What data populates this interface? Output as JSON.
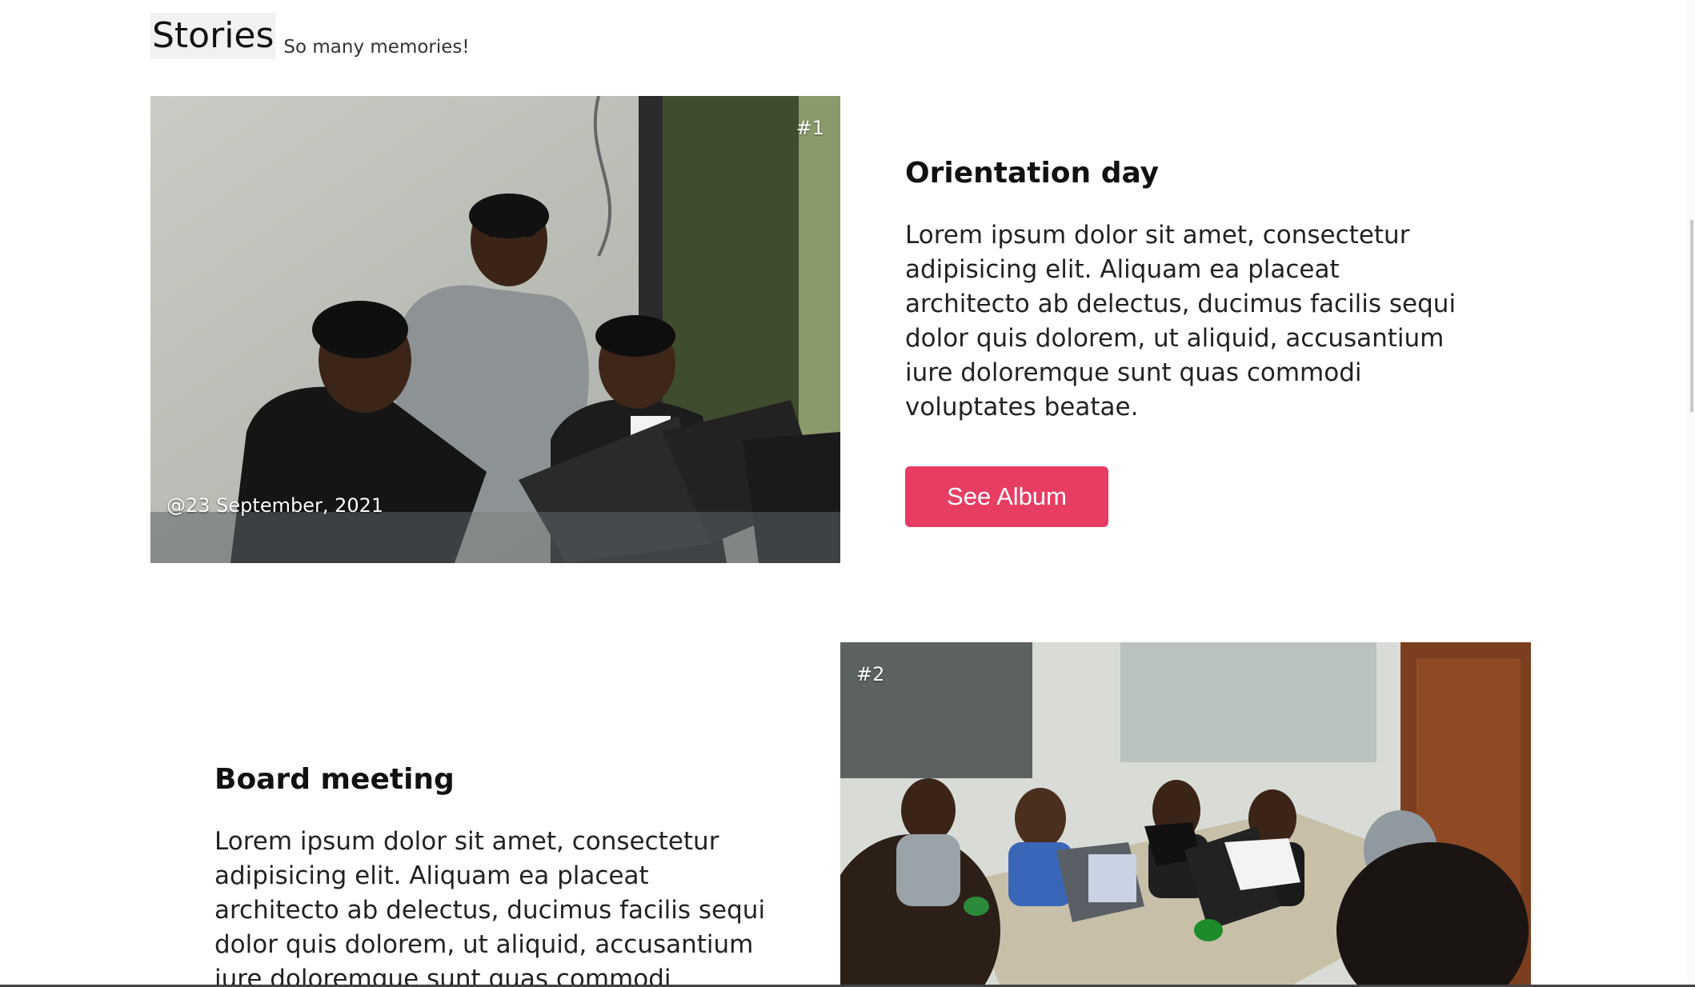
{
  "header": {
    "title": "Stories",
    "subtitle": "So many memories!"
  },
  "stories": [
    {
      "number": "#1",
      "date": "@23 September, 2021",
      "title": "Orientation day",
      "body": "Lorem ipsum dolor sit amet, consectetur adipisicing elit. Aliquam ea placeat architecto ab delectus, ducimus facilis sequi dolor quis dolorem, ut aliquid, accusantium iure doloremque sunt quas commodi voluptates beatae.",
      "button_label": "See Album"
    },
    {
      "number": "#2",
      "title": "Board meeting",
      "body": "Lorem ipsum dolor sit amet, consectetur adipisicing elit. Aliquam ea placeat architecto ab delectus, ducimus facilis sequi dolor quis dolorem, ut aliquid, accusantium iure doloremque sunt quas commodi voluptates beatae."
    }
  ],
  "colors": {
    "accent": "#e83d63"
  }
}
